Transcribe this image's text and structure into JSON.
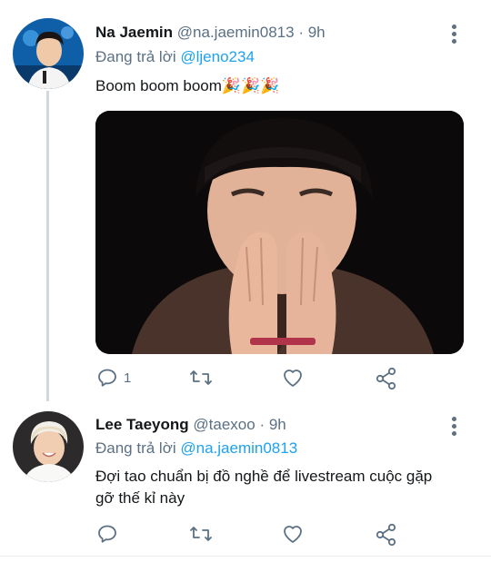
{
  "tweets": [
    {
      "name": "Na Jaemin",
      "handle": "@na.jaemin0813",
      "separator": "·",
      "time": "9h",
      "reply_prefix": "Đang trả lời",
      "reply_to": "@ljeno234",
      "text": "Boom boom boom",
      "emoji": "🎉🎉🎉",
      "reply_count": "1",
      "icons": [
        "reply-icon",
        "retweet-icon",
        "like-icon",
        "share-icon"
      ]
    },
    {
      "name": "Lee Taeyong",
      "handle": "@taexoo",
      "separator": "·",
      "time": "9h",
      "reply_prefix": "Đang trả lời",
      "reply_to": "@na.jaemin0813",
      "text": "Đợi tao chuẩn bị đồ nghề để livestream cuộc gặp gỡ thế kỉ này",
      "reply_count": "",
      "icons": [
        "reply-icon",
        "retweet-icon",
        "like-icon",
        "share-icon"
      ]
    }
  ],
  "colors": {
    "link": "#1da1f2",
    "secondary_text": "#5b7083",
    "thread_line": "#cfd9de"
  }
}
